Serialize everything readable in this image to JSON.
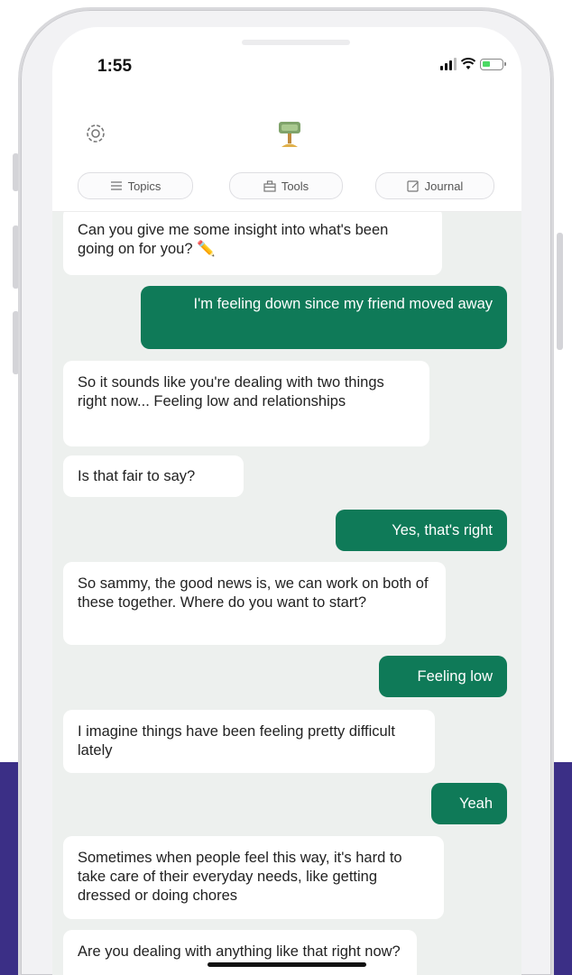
{
  "status_bar": {
    "time": "1:55"
  },
  "tabs": [
    {
      "label": "Topics",
      "icon": "list-icon"
    },
    {
      "label": "Tools",
      "icon": "toolbox-icon"
    },
    {
      "label": "Journal",
      "icon": "journal-icon"
    }
  ],
  "messages": [
    {
      "sender": "bot",
      "text": "Can you give me some insight into what's been going on for you? ✏️"
    },
    {
      "sender": "user",
      "text": "I'm feeling down since my friend moved away"
    },
    {
      "sender": "bot",
      "text": "So it sounds like you're dealing with two things right now... Feeling low and relationships"
    },
    {
      "sender": "bot",
      "text": "Is that fair to say?"
    },
    {
      "sender": "user",
      "text": "Yes, that's right"
    },
    {
      "sender": "bot",
      "text": "So sammy, the good news is, we can work on both of these together. Where do you want to start?"
    },
    {
      "sender": "user",
      "text": "Feeling low"
    },
    {
      "sender": "bot",
      "text": "I imagine things have been feeling pretty difficult lately"
    },
    {
      "sender": "user",
      "text": "Yeah"
    },
    {
      "sender": "bot",
      "text": "Sometimes when people feel this way, it's hard to take care of their everyday needs, like getting dressed or doing chores"
    },
    {
      "sender": "bot",
      "text": "Are you dealing with anything like that right now?"
    }
  ],
  "colors": {
    "user_bubble": "#0f7a58",
    "chat_background": "#edf0ee",
    "page_band": "#3b2f86"
  }
}
